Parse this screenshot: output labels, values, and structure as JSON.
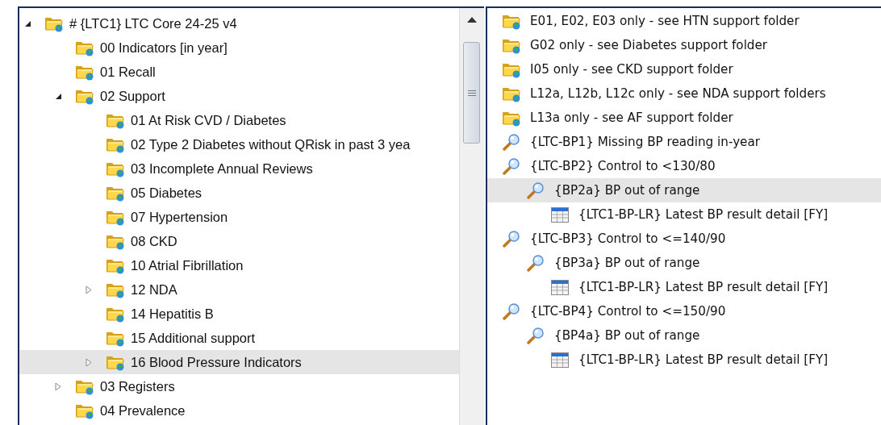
{
  "left_tree": {
    "items": [
      {
        "label": "# {LTC1} LTC Core 24-25 v4",
        "selected": false,
        "expanded": true,
        "children": [
          {
            "label": "00 Indicators [in year]",
            "selected": false
          },
          {
            "label": "01 Recall",
            "selected": false
          },
          {
            "label": "02 Support",
            "selected": false,
            "expanded": true,
            "children": [
              {
                "label": "01 At Risk CVD / Diabetes",
                "selected": false
              },
              {
                "label": "02 Type 2 Diabetes without QRisk in past 3 yea",
                "selected": false
              },
              {
                "label": "03 Incomplete Annual Reviews",
                "selected": false
              },
              {
                "label": "05 Diabetes",
                "selected": false
              },
              {
                "label": "07 Hypertension",
                "selected": false
              },
              {
                "label": "08  CKD",
                "selected": false
              },
              {
                "label": "10 Atrial Fibrillation",
                "selected": false
              },
              {
                "label": "12  NDA",
                "selected": false,
                "expanded": false
              },
              {
                "label": "14  Hepatitis B",
                "selected": false
              },
              {
                "label": "15 Additional support",
                "selected": false
              },
              {
                "label": "16 Blood Pressure Indicators",
                "selected": true,
                "expanded": false
              }
            ]
          },
          {
            "label": "03 Registers",
            "selected": false,
            "expanded": false
          },
          {
            "label": "04 Prevalence",
            "selected": false
          }
        ]
      }
    ]
  },
  "right_list": {
    "items": [
      {
        "kind": "folder",
        "label": "E01, E02, E03 only - see HTN support folder",
        "selected": false
      },
      {
        "kind": "folder",
        "label": "G02 only - see Diabetes support folder",
        "selected": false
      },
      {
        "kind": "folder",
        "label": "I05 only - see CKD support folder",
        "selected": false
      },
      {
        "kind": "folder",
        "label": "L12a, L12b, L12c only - see NDA support folders",
        "selected": false
      },
      {
        "kind": "folder",
        "label": "L13a only - see AF support folder",
        "selected": false
      },
      {
        "kind": "search",
        "label": "{LTC-BP1} Missing BP reading in-year",
        "selected": false
      },
      {
        "kind": "search",
        "label": "{LTC-BP2} Control to <130/80",
        "selected": false,
        "children": [
          {
            "kind": "search",
            "label": "{BP2a} BP out of range",
            "selected": true,
            "children": [
              {
                "kind": "table",
                "label": "{LTC1-BP-LR} Latest BP result detail [FY]",
                "selected": false
              }
            ]
          }
        ]
      },
      {
        "kind": "search",
        "label": "{LTC-BP3} Control to <=140/90",
        "selected": false,
        "children": [
          {
            "kind": "search",
            "label": "{BP3a} BP out of range",
            "selected": false,
            "children": [
              {
                "kind": "table",
                "label": "{LTC1-BP-LR} Latest BP result detail [FY]",
                "selected": false
              }
            ]
          }
        ]
      },
      {
        "kind": "search",
        "label": "{LTC-BP4} Control to <=150/90",
        "selected": false,
        "children": [
          {
            "kind": "search",
            "label": "{BP4a} BP out of range",
            "selected": false,
            "children": [
              {
                "kind": "table",
                "label": "{LTC1-BP-LR} Latest BP result detail [FY]",
                "selected": false
              }
            ]
          }
        ]
      }
    ]
  }
}
